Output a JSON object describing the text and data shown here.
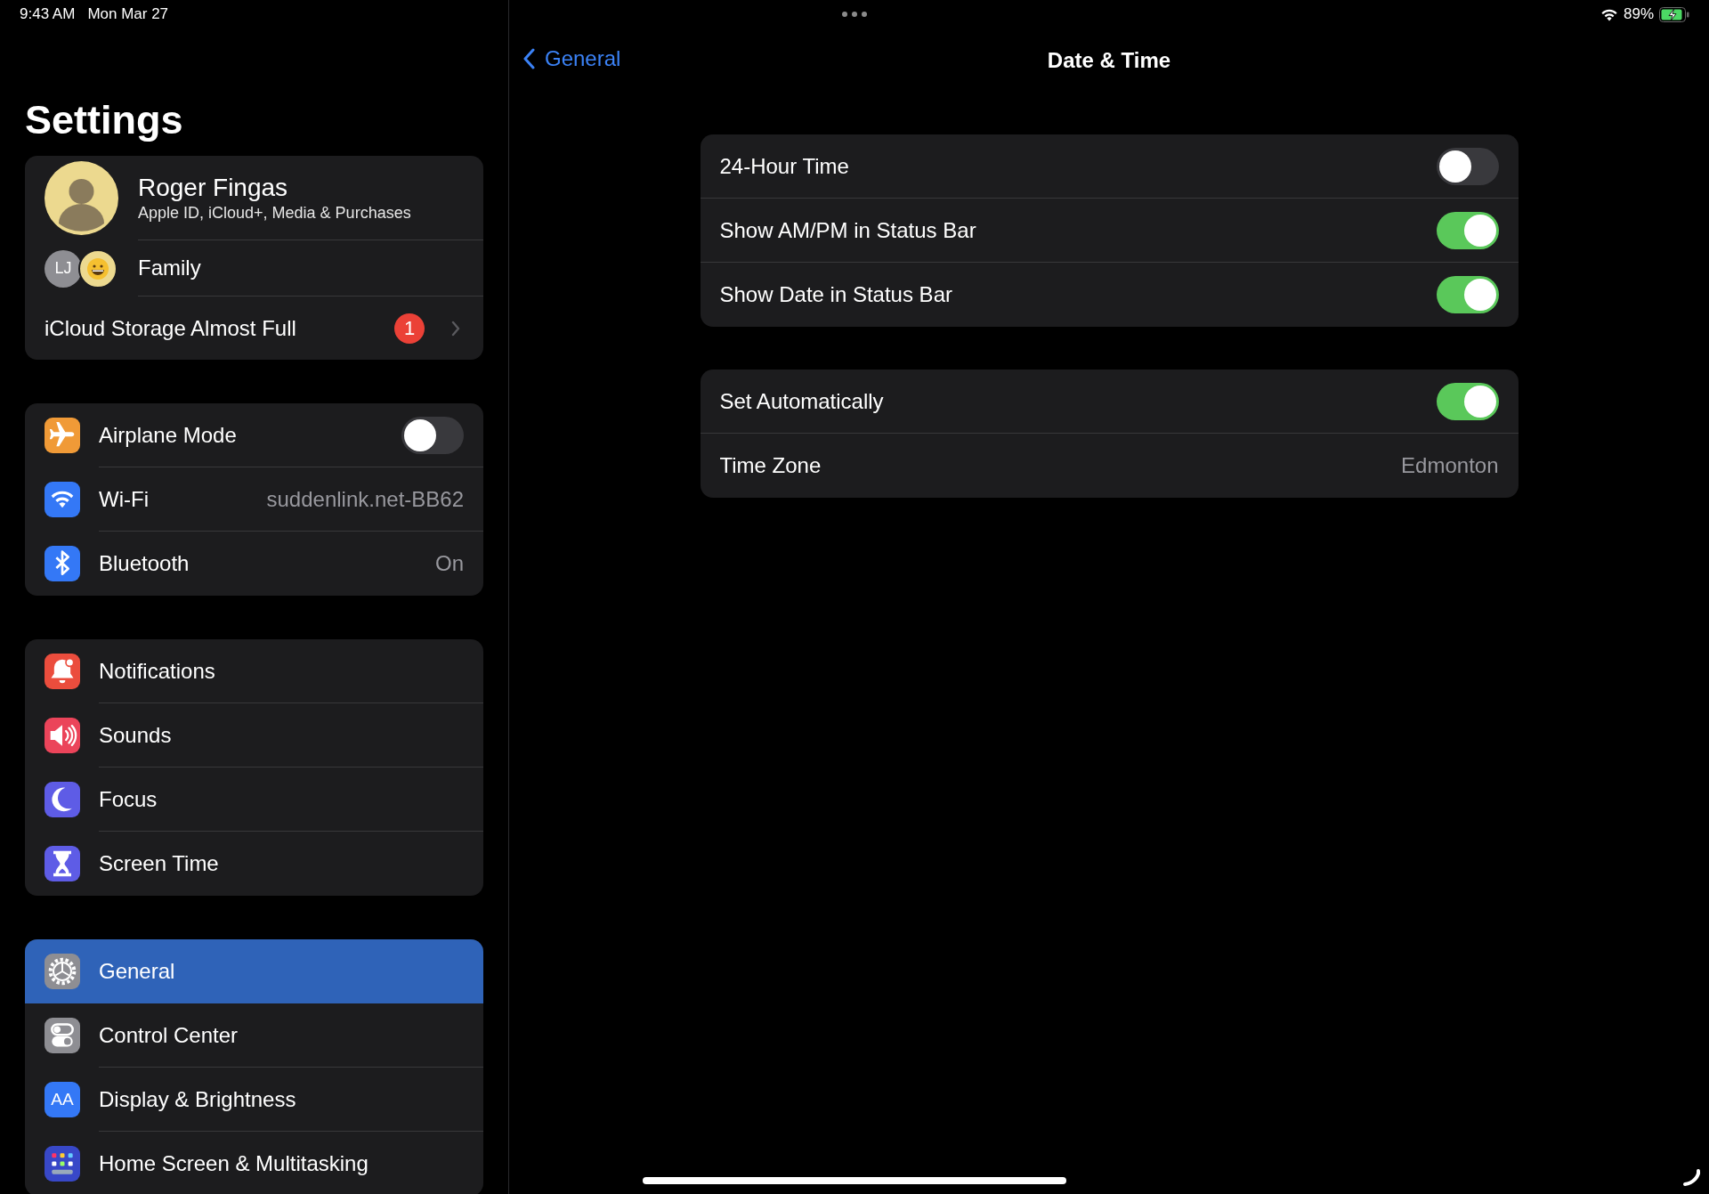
{
  "status_bar": {
    "time": "9:43 AM",
    "date": "Mon Mar 27",
    "battery": "89%"
  },
  "sidebar": {
    "title": "Settings",
    "profile": {
      "name": "Roger Fingas",
      "subtitle": "Apple ID, iCloud+, Media & Purchases"
    },
    "family": {
      "initials": "LJ",
      "label": "Family"
    },
    "storage_alert": {
      "label": "iCloud Storage Almost Full",
      "badge": "1"
    },
    "groups": [
      {
        "items": [
          {
            "label": "Airplane Mode",
            "kind": "toggle",
            "on": false,
            "color": "#f09a37",
            "selected": false
          },
          {
            "label": "Wi-Fi",
            "kind": "value",
            "value": "suddenlink.net-BB62",
            "color": "#3478f6",
            "selected": false
          },
          {
            "label": "Bluetooth",
            "kind": "value",
            "value": "On",
            "color": "#3478f6",
            "selected": false
          }
        ]
      },
      {
        "items": [
          {
            "label": "Notifications",
            "kind": "link",
            "color": "#eb4d3d",
            "selected": false
          },
          {
            "label": "Sounds",
            "kind": "link",
            "color": "#eb445a",
            "selected": false
          },
          {
            "label": "Focus",
            "kind": "link",
            "color": "#5e5ce6",
            "selected": false
          },
          {
            "label": "Screen Time",
            "kind": "link",
            "color": "#5e5ce6",
            "selected": false
          }
        ]
      },
      {
        "items": [
          {
            "label": "General",
            "kind": "link",
            "color": "#8e8e93",
            "selected": true
          },
          {
            "label": "Control Center",
            "kind": "link",
            "color": "#8e8e93",
            "selected": false
          },
          {
            "label": "Display & Brightness",
            "kind": "link",
            "color": "#3478f6",
            "glyph": "AA",
            "selected": false
          },
          {
            "label": "Home Screen & Multitasking",
            "kind": "link",
            "color": "#3848c8",
            "selected": false
          }
        ]
      }
    ]
  },
  "detail": {
    "back": "General",
    "title": "Date & Time",
    "groups": [
      {
        "rows": [
          {
            "label": "24-Hour Time",
            "kind": "toggle",
            "on": false
          },
          {
            "label": "Show AM/PM in Status Bar",
            "kind": "toggle",
            "on": true
          },
          {
            "label": "Show Date in Status Bar",
            "kind": "toggle",
            "on": true
          }
        ]
      },
      {
        "rows": [
          {
            "label": "Set Automatically",
            "kind": "toggle",
            "on": true
          },
          {
            "label": "Time Zone",
            "kind": "value",
            "value": "Edmonton"
          }
        ]
      }
    ]
  }
}
